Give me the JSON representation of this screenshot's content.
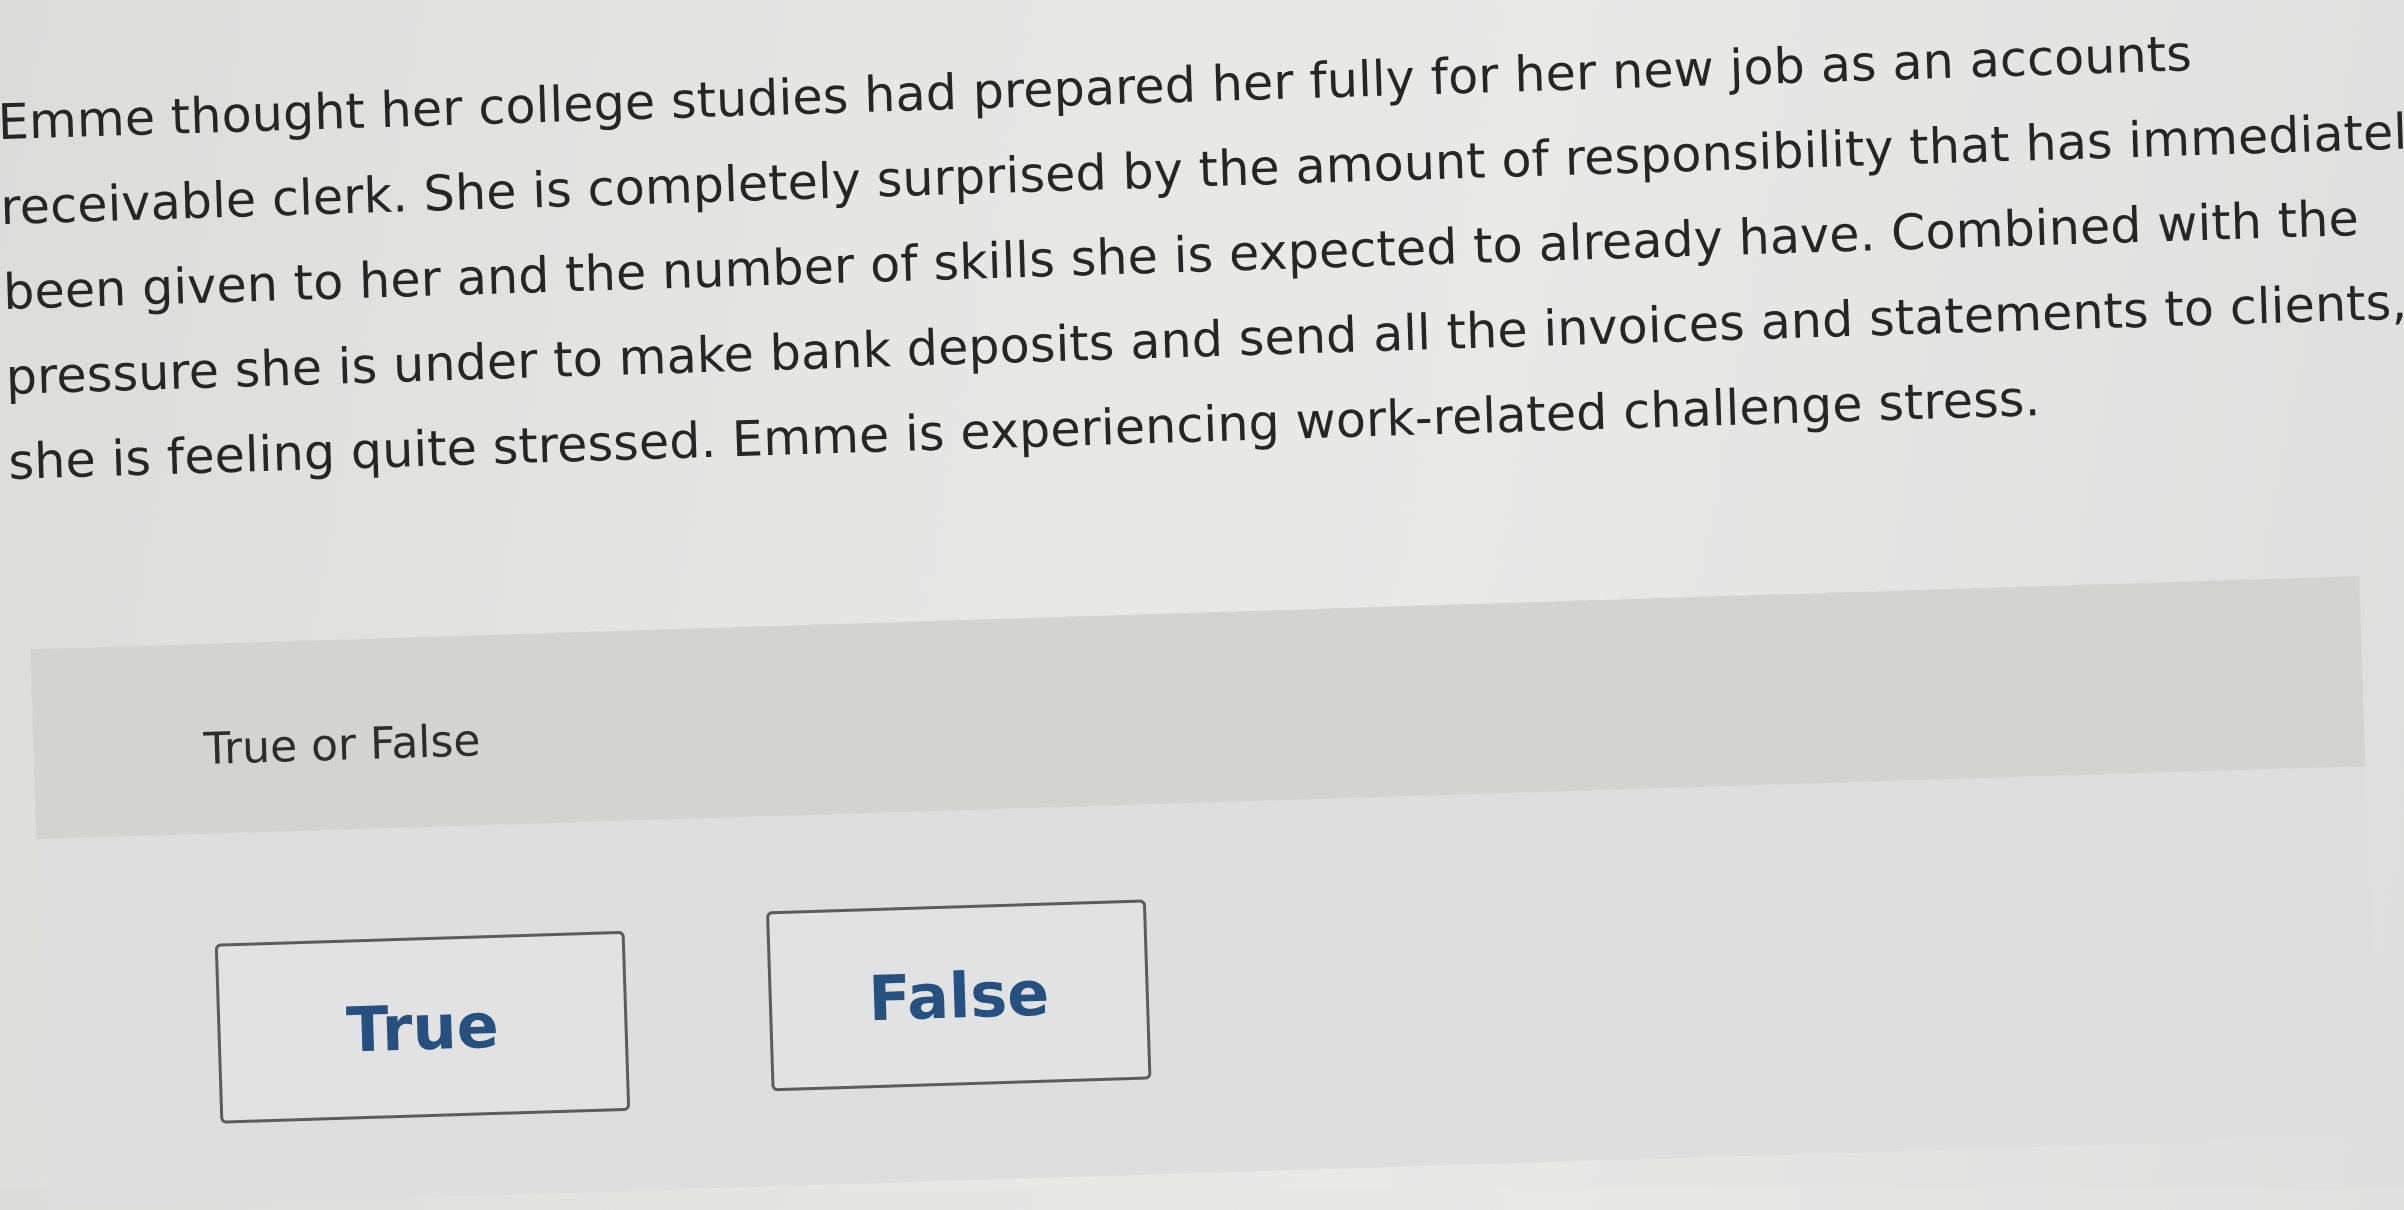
{
  "question": {
    "passage_lines": [
      "Emme thought her college studies had prepared her fully for her new job as an accounts",
      "receivable clerk. She is completely surprised by the amount of responsibility that has immediately",
      "been given to her and the number of skills she is expected to already have. Combined with the",
      "pressure she is under to make bank deposits and send all the invoices and statements to clients,",
      "she is feeling quite stressed. Emme is experiencing work-related challenge stress."
    ],
    "type_label": "True or False"
  },
  "answers": {
    "true_label": "True",
    "false_label": "False"
  },
  "colors": {
    "answer_text": "#26507f",
    "answer_border": "#5c5c5c",
    "panel_header": "#d3d3d2",
    "panel_body": "#dedede"
  }
}
